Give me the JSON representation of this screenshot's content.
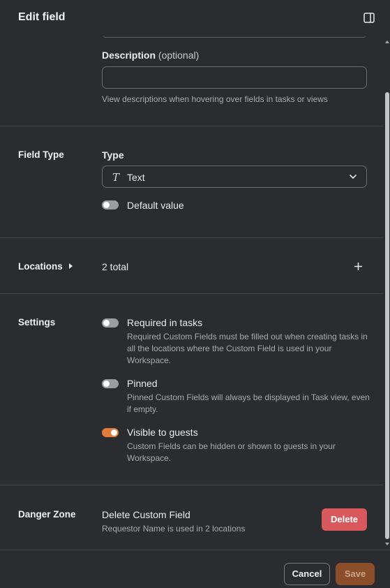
{
  "header": {
    "title": "Edit field",
    "panel_icon": "sidebar-toggle-icon"
  },
  "description": {
    "label": "Description",
    "optional": "(optional)",
    "value": "",
    "hint": "View descriptions when hovering over fields in tasks or views"
  },
  "field_type": {
    "section_title": "Field Type",
    "type_label": "Type",
    "type_icon": "T",
    "type_value": "Text",
    "default_value_label": "Default value",
    "default_value_enabled": false
  },
  "locations": {
    "section_title": "Locations",
    "total": "2 total",
    "add_icon": "plus-icon"
  },
  "settings": {
    "section_title": "Settings",
    "items": [
      {
        "label": "Required in tasks",
        "enabled": false,
        "hint_lines": [
          "Required Custom Fields must be filled out when creating tasks in",
          "all the locations where the Custom Field is used in your",
          "Workspace."
        ]
      },
      {
        "label": "Pinned",
        "enabled": false,
        "hint_lines": [
          "Pinned Custom Fields will always be displayed in Task view, even",
          "if empty."
        ]
      },
      {
        "label": "Visible to guests",
        "enabled": true,
        "hint_lines": [
          "Custom Fields can be hidden or shown to guests in your",
          "Workspace."
        ]
      }
    ]
  },
  "danger_zone": {
    "section_title": "Danger Zone",
    "title": "Delete Custom Field",
    "hint": "Requestor Name is used in 2 locations",
    "delete_label": "Delete"
  },
  "footer": {
    "cancel_label": "Cancel",
    "save_label": "Save"
  },
  "colors": {
    "background": "#2b2c30",
    "accent_orange": "#e07b3a",
    "danger": "#d9585e",
    "save_disabled": "#8a4f2a"
  }
}
